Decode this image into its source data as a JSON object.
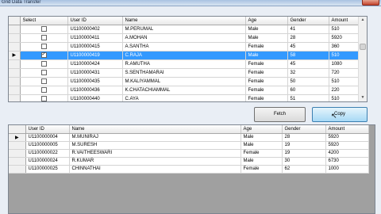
{
  "window": {
    "title": "Grid Data Transfer"
  },
  "top_grid": {
    "columns": [
      "Select",
      "User ID",
      "Name",
      "Age",
      "Gender",
      "Amount"
    ],
    "rows": [
      {
        "checked": false,
        "user_id": "U1100000402",
        "name": "M.PERUMAL",
        "age": "Male",
        "gender": "41",
        "amount": "510"
      },
      {
        "checked": false,
        "user_id": "U1100000411",
        "name": "A.MOHAN",
        "age": "Male",
        "gender": "28",
        "amount": "5920"
      },
      {
        "checked": false,
        "user_id": "U1100000415",
        "name": "A.SANTHA",
        "age": "Female",
        "gender": "45",
        "amount": "360"
      },
      {
        "checked": true,
        "user_id": "U1100000419",
        "name": "C.RAJA",
        "age": "Male",
        "gender": "58",
        "amount": "510"
      },
      {
        "checked": false,
        "user_id": "U1100000424",
        "name": "R.AMUTHA",
        "age": "Female",
        "gender": "45",
        "amount": "1080"
      },
      {
        "checked": false,
        "user_id": "U1100000431",
        "name": "S.SENTHAMARAI",
        "age": "Female",
        "gender": "32",
        "amount": "720"
      },
      {
        "checked": false,
        "user_id": "U1100000435",
        "name": "M.KALIYAMMAL",
        "age": "Female",
        "gender": "50",
        "amount": "510"
      },
      {
        "checked": false,
        "user_id": "U1100000436",
        "name": "K.CHATACHIAMMAL",
        "age": "Female",
        "gender": "60",
        "amount": "220"
      },
      {
        "checked": false,
        "user_id": "U1100000440",
        "name": "C.AYA",
        "age": "Female",
        "gender": "51",
        "amount": "510"
      }
    ]
  },
  "buttons": {
    "fetch": "Fetch",
    "copy": "Copy"
  },
  "bottom_grid": {
    "columns": [
      "User ID",
      "Name",
      "Age",
      "Gender",
      "Amount"
    ],
    "rows": [
      {
        "user_id": "U1100000004",
        "name": "M.MUNIRAJ",
        "age": "Male",
        "gender": "28",
        "amount": "5920"
      },
      {
        "user_id": "U1100000005",
        "name": "M.SURESH",
        "age": "Male",
        "gender": "19",
        "amount": "5920"
      },
      {
        "user_id": "U1100000022",
        "name": "R.VAITHEESWARI",
        "age": "Female",
        "gender": "19",
        "amount": "4200"
      },
      {
        "user_id": "U1100000024",
        "name": "R.KUMAR",
        "age": "Male",
        "gender": "30",
        "amount": "6730"
      },
      {
        "user_id": "U1100000025",
        "name": "CHINNATHAI",
        "age": "Female",
        "gender": "62",
        "amount": "1000"
      }
    ]
  },
  "icons": {
    "row_indicator": "▶",
    "check": "✓",
    "scroll_up": "▲",
    "scroll_down": "▼",
    "cursor": "↖"
  },
  "colors": {
    "selection": "#3399ff",
    "copy_button": "#a7d9f5"
  }
}
